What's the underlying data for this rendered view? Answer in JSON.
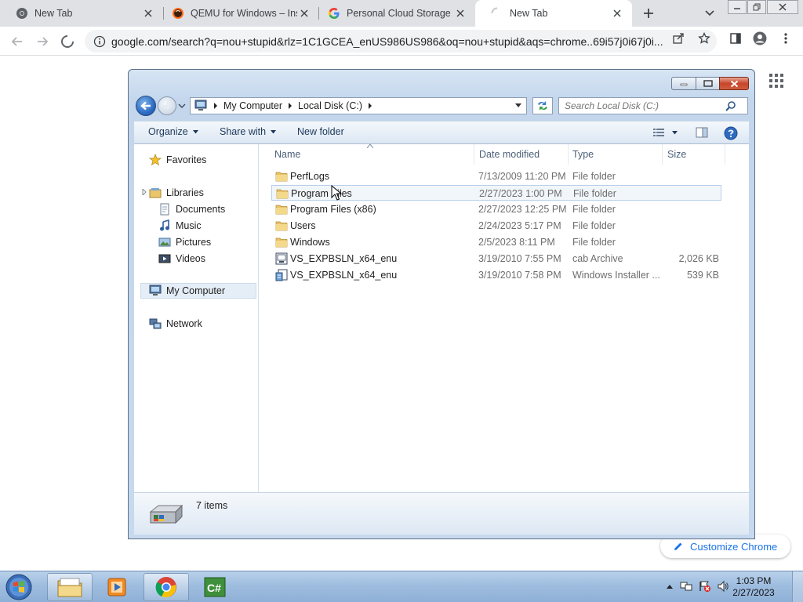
{
  "browser": {
    "tabs": [
      {
        "title": "New Tab",
        "favicon": "chrome-icon"
      },
      {
        "title": "QEMU for Windows – Ins",
        "favicon": "qemu-icon"
      },
      {
        "title": "Personal Cloud Storage &",
        "favicon": "google-icon"
      },
      {
        "title": "New Tab",
        "favicon": "loading-spinner-icon"
      }
    ],
    "url": "google.com/search?q=nou+stupid&rlz=1C1GCEA_enUS986US986&oq=nou+stupid&aqs=chrome..69i57j0i67j0i...",
    "customize_label": "Customize Chrome"
  },
  "explorer": {
    "breadcrumb": [
      "My Computer",
      "Local Disk (C:)"
    ],
    "search_placeholder": "Search Local Disk (C:)",
    "commands": {
      "organize": "Organize",
      "share": "Share with",
      "new_folder": "New folder"
    },
    "nav": {
      "favorites": "Favorites",
      "libraries": "Libraries",
      "documents": "Documents",
      "music": "Music",
      "pictures": "Pictures",
      "videos": "Videos",
      "my_computer": "My Computer",
      "network": "Network"
    },
    "columns": {
      "name": "Name",
      "date": "Date modified",
      "type": "Type",
      "size": "Size"
    },
    "files": [
      {
        "name": "PerfLogs",
        "date": "7/13/2009 11:20 PM",
        "type": "File folder",
        "size": "",
        "icon": "folder-icon"
      },
      {
        "name": "Program Files",
        "date": "2/27/2023 1:00 PM",
        "type": "File folder",
        "size": "",
        "icon": "folder-icon"
      },
      {
        "name": "Program Files (x86)",
        "date": "2/27/2023 12:25 PM",
        "type": "File folder",
        "size": "",
        "icon": "folder-icon"
      },
      {
        "name": "Users",
        "date": "2/24/2023 5:17 PM",
        "type": "File folder",
        "size": "",
        "icon": "folder-icon"
      },
      {
        "name": "Windows",
        "date": "2/5/2023 8:11 PM",
        "type": "File folder",
        "size": "",
        "icon": "folder-icon"
      },
      {
        "name": "VS_EXPBSLN_x64_enu",
        "date": "3/19/2010 7:55 PM",
        "type": "cab Archive",
        "size": "2,026 KB",
        "icon": "cab-file-icon"
      },
      {
        "name": "VS_EXPBSLN_x64_enu",
        "date": "3/19/2010 7:58 PM",
        "type": "Windows Installer ...",
        "size": "539 KB",
        "icon": "msi-file-icon"
      }
    ],
    "status": "7 items"
  },
  "taskbar": {
    "clock_time": "1:03 PM",
    "clock_date": "2/27/2023"
  },
  "colors": {
    "chrome_tabstrip": "#dfe1e5",
    "explorer_frame": "#c6d9ee",
    "taskbar": "#9ebddf",
    "close_red": "#c7452b",
    "link_blue": "#1a73e8"
  }
}
